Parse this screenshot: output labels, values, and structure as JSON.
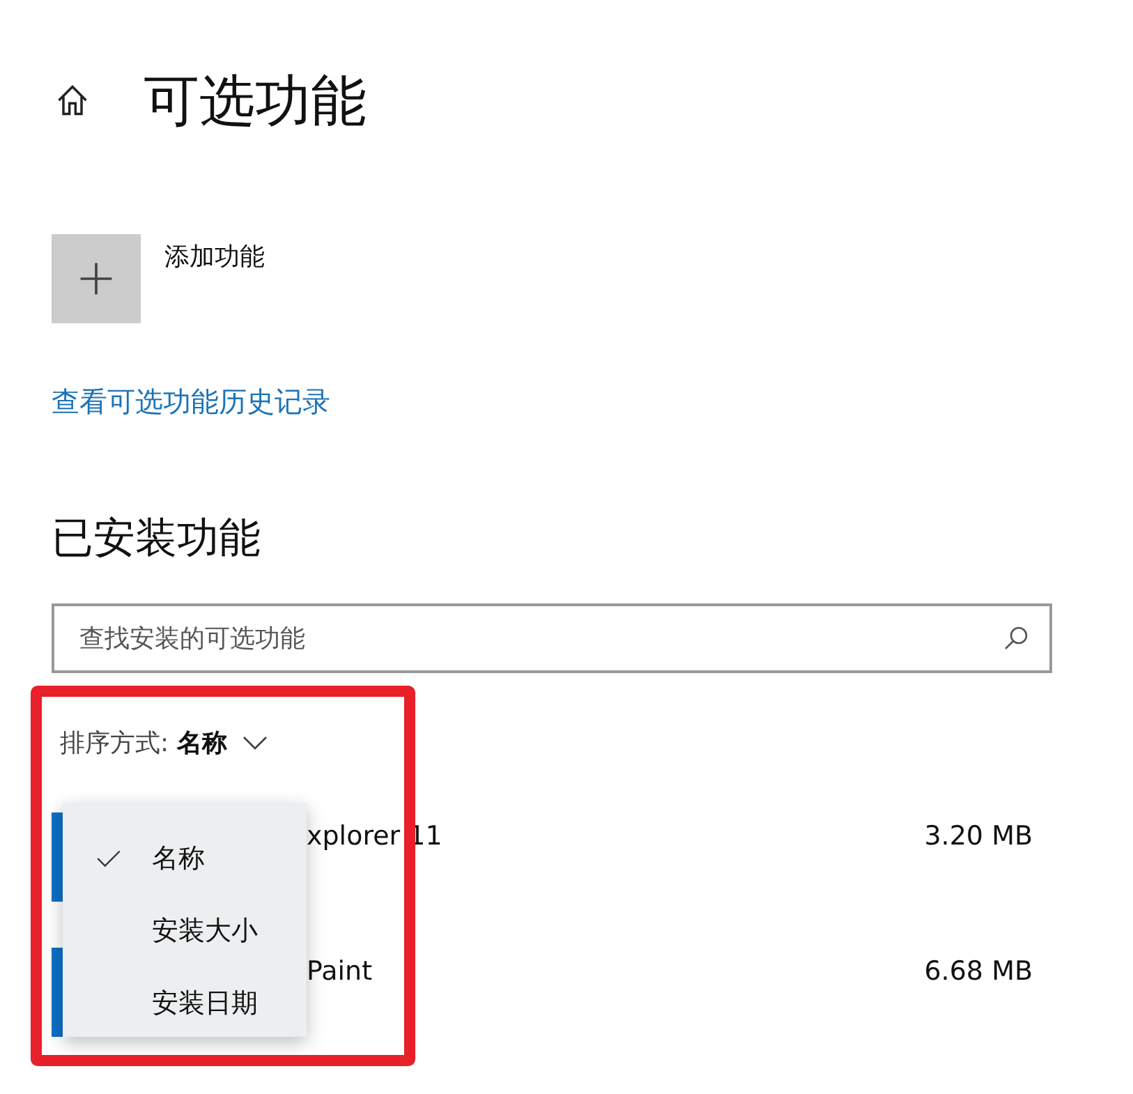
{
  "header": {
    "title": "可选功能"
  },
  "add_feature": {
    "label": "添加功能"
  },
  "history_link": "查看可选功能历史记录",
  "installed": {
    "heading": "已安装功能",
    "search": {
      "placeholder": "查找安装的可选功能"
    },
    "sort": {
      "label": "排序方式:",
      "value": "名称"
    },
    "sort_menu": [
      {
        "label": "名称",
        "selected": true
      },
      {
        "label": "安装大小",
        "selected": false
      },
      {
        "label": "安装日期",
        "selected": false
      }
    ],
    "features": [
      {
        "name": "xplorer 11",
        "size": "3.20 MB"
      },
      {
        "name": "Paint",
        "size": "6.68 MB"
      }
    ]
  },
  "annotation": {
    "kind": "frame"
  }
}
